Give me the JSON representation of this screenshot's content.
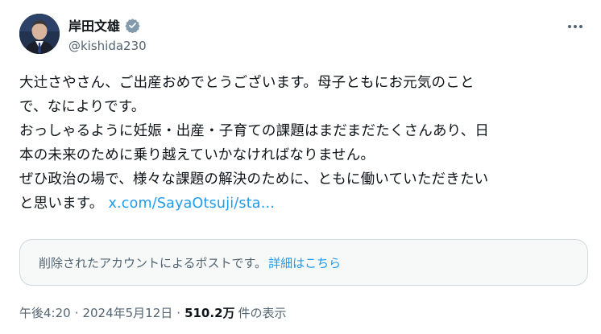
{
  "author": {
    "display_name": "岸田文雄",
    "handle": "@kishida230"
  },
  "post": {
    "lines": [
      "大辻さやさん、ご出産おめでとうございます。母子ともにお元気のこと",
      "で、なによりです。",
      "おっしゃるように妊娠・出産・子育ての課題はまだまだたくさんあり、日",
      "本の未来のために乗り越えていかなければなりません。",
      "ぜひ政治の場で、様々な課題の解決のために、ともに働いていただきたい",
      "と思います。"
    ],
    "link_text": "x.com/SayaOtsuji/sta..."
  },
  "quote": {
    "notice": "削除されたアカウントによるポストです。",
    "link": "詳細はこちら"
  },
  "meta": {
    "time": "午後4:20",
    "separator": "·",
    "date": "2024年5月12日",
    "views_count": "510.2万",
    "views_label": "件の表示"
  },
  "colors": {
    "accent": "#1d9bf0",
    "secondary_text": "#536471",
    "verified_badge": "#829aab"
  },
  "icons": {
    "verified": "verified-badge-icon",
    "more": "more-horizontal-icon"
  }
}
